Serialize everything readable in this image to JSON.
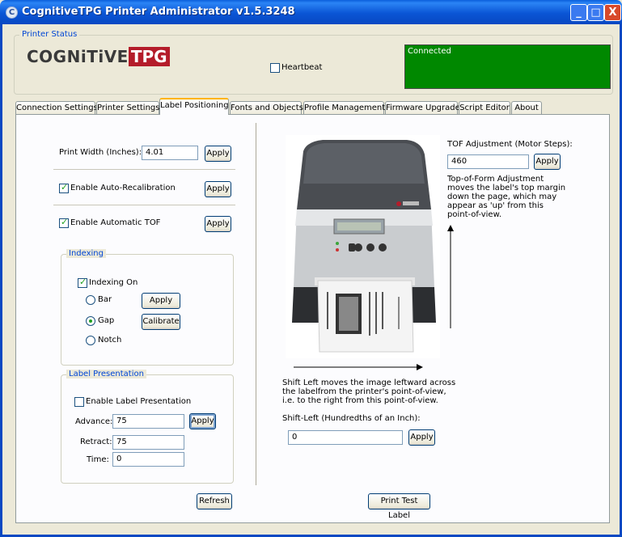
{
  "window": {
    "title": "CognitiveTPG Printer Administrator v1.5.3248",
    "controls": {
      "minimize": "_",
      "maximize": "□",
      "close": "X"
    }
  },
  "printer_status": {
    "legend": "Printer Status",
    "logo": {
      "part1": "COGNiTiVE",
      "part2": "TPG"
    },
    "heartbeat_label": "Heartbeat",
    "heartbeat_checked": false,
    "status_text": "Connected",
    "status_color": "#008800"
  },
  "tabs": [
    {
      "label": "Connection Settings",
      "active": false
    },
    {
      "label": "Printer Settings",
      "active": false
    },
    {
      "label": "Label Positioning",
      "active": true
    },
    {
      "label": "Fonts and Objects",
      "active": false
    },
    {
      "label": "Profile Management",
      "active": false
    },
    {
      "label": "Firmware Upgrade",
      "active": false
    },
    {
      "label": "Script Editor",
      "active": false
    },
    {
      "label": "About",
      "active": false
    }
  ],
  "print_width": {
    "label": "Print Width (Inches):",
    "value": "4.01",
    "apply": "Apply"
  },
  "auto_recal": {
    "label": "Enable Auto-Recalibration",
    "checked": true,
    "apply": "Apply"
  },
  "auto_tof": {
    "label": "Enable Automatic TOF",
    "checked": true,
    "apply": "Apply"
  },
  "indexing": {
    "legend": "Indexing",
    "on_label": "Indexing On",
    "on_checked": true,
    "options": [
      {
        "label": "Bar",
        "selected": false
      },
      {
        "label": "Gap",
        "selected": true
      },
      {
        "label": "Notch",
        "selected": false
      }
    ],
    "apply": "Apply",
    "calibrate": "Calibrate"
  },
  "label_presentation": {
    "legend": "Label Presentation",
    "enable_label": "Enable Label Presentation",
    "enable_checked": false,
    "advance_label": "Advance:",
    "advance_value": "75",
    "retract_label": "Retract:",
    "retract_value": "75",
    "time_label": "Time:",
    "time_value": "0",
    "apply": "Apply"
  },
  "refresh": "Refresh",
  "tof": {
    "label": "TOF Adjustment (Motor Steps):",
    "value": "460",
    "apply": "Apply",
    "description": "Top-of-Form Adjustment moves the label's top margin down the page, which may appear as 'up' from this point-of-view."
  },
  "shift": {
    "description": "Shift Left moves the image leftward across the labelfrom the printer's point-of-view, i.e. to the right from this point-of-view.",
    "label": "Shift-Left (Hundredths of an Inch):",
    "value": "0",
    "apply": "Apply"
  },
  "print_test": "Print Test Label"
}
